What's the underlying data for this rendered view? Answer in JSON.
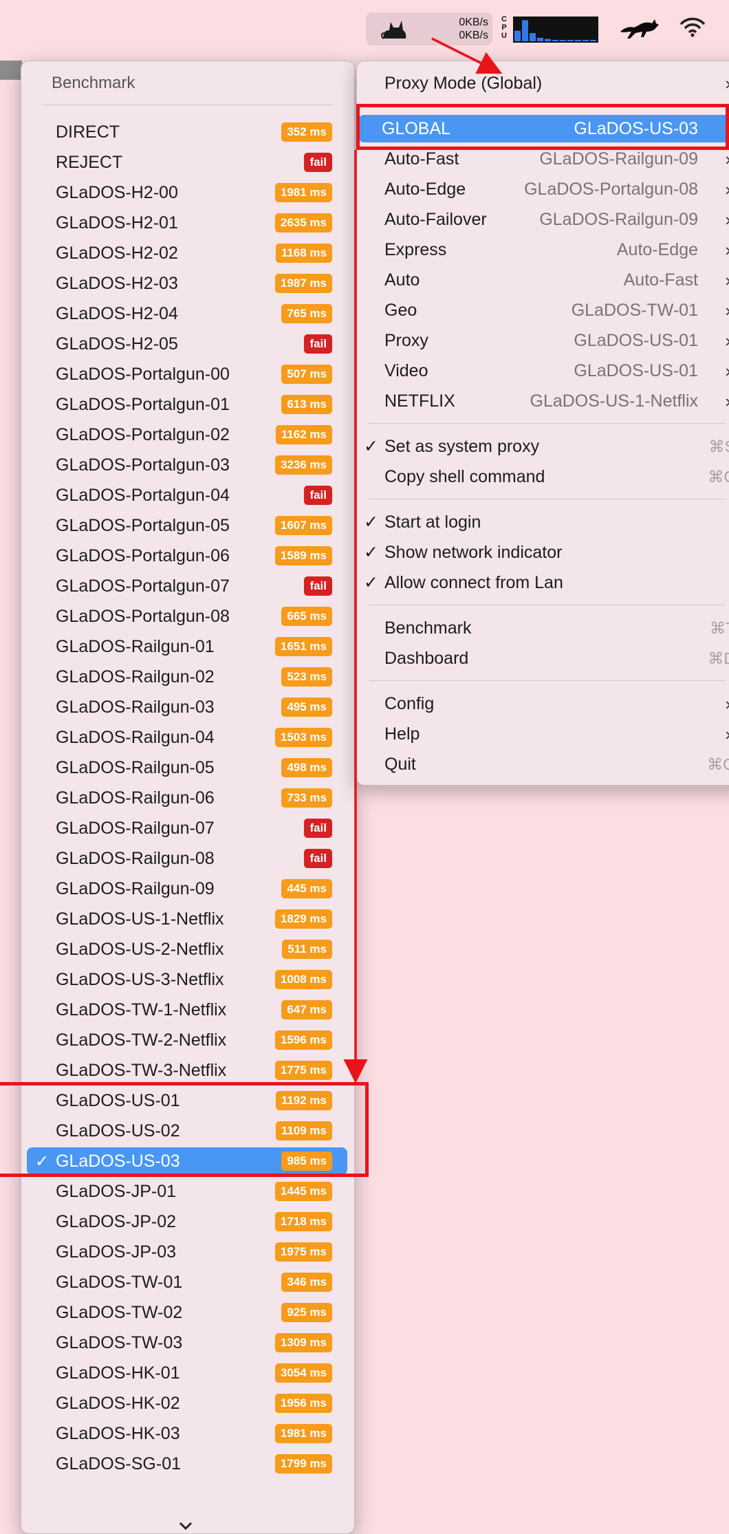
{
  "menubar": {
    "upload_rate": "0KB/s",
    "download_rate": "0KB/s",
    "cpu_label": "CPU",
    "cpu_levels": [
      0.45,
      0.9,
      0.35,
      0.15,
      0.1,
      0.05,
      0.05,
      0.05,
      0.05,
      0.05,
      0.05
    ],
    "icons": [
      "cat-icon",
      "cpu-graph",
      "runcat-icon",
      "wifi-icon"
    ]
  },
  "benchmark_menu": {
    "title": "Benchmark",
    "items": [
      {
        "label": "DIRECT",
        "latency": "352 ms",
        "status": "ok"
      },
      {
        "label": "REJECT",
        "latency": "fail",
        "status": "fail"
      },
      {
        "label": "GLaDOS-H2-00",
        "latency": "1981 ms",
        "status": "ok"
      },
      {
        "label": "GLaDOS-H2-01",
        "latency": "2635 ms",
        "status": "ok"
      },
      {
        "label": "GLaDOS-H2-02",
        "latency": "1168 ms",
        "status": "ok"
      },
      {
        "label": "GLaDOS-H2-03",
        "latency": "1987 ms",
        "status": "ok"
      },
      {
        "label": "GLaDOS-H2-04",
        "latency": "765 ms",
        "status": "ok"
      },
      {
        "label": "GLaDOS-H2-05",
        "latency": "fail",
        "status": "fail"
      },
      {
        "label": "GLaDOS-Portalgun-00",
        "latency": "507 ms",
        "status": "ok"
      },
      {
        "label": "GLaDOS-Portalgun-01",
        "latency": "613 ms",
        "status": "ok"
      },
      {
        "label": "GLaDOS-Portalgun-02",
        "latency": "1162 ms",
        "status": "ok"
      },
      {
        "label": "GLaDOS-Portalgun-03",
        "latency": "3236 ms",
        "status": "ok"
      },
      {
        "label": "GLaDOS-Portalgun-04",
        "latency": "fail",
        "status": "fail"
      },
      {
        "label": "GLaDOS-Portalgun-05",
        "latency": "1607 ms",
        "status": "ok"
      },
      {
        "label": "GLaDOS-Portalgun-06",
        "latency": "1589 ms",
        "status": "ok"
      },
      {
        "label": "GLaDOS-Portalgun-07",
        "latency": "fail",
        "status": "fail"
      },
      {
        "label": "GLaDOS-Portalgun-08",
        "latency": "665 ms",
        "status": "ok"
      },
      {
        "label": "GLaDOS-Railgun-01",
        "latency": "1651 ms",
        "status": "ok"
      },
      {
        "label": "GLaDOS-Railgun-02",
        "latency": "523 ms",
        "status": "ok"
      },
      {
        "label": "GLaDOS-Railgun-03",
        "latency": "495 ms",
        "status": "ok"
      },
      {
        "label": "GLaDOS-Railgun-04",
        "latency": "1503 ms",
        "status": "ok"
      },
      {
        "label": "GLaDOS-Railgun-05",
        "latency": "498 ms",
        "status": "ok"
      },
      {
        "label": "GLaDOS-Railgun-06",
        "latency": "733 ms",
        "status": "ok"
      },
      {
        "label": "GLaDOS-Railgun-07",
        "latency": "fail",
        "status": "fail"
      },
      {
        "label": "GLaDOS-Railgun-08",
        "latency": "fail",
        "status": "fail"
      },
      {
        "label": "GLaDOS-Railgun-09",
        "latency": "445 ms",
        "status": "ok"
      },
      {
        "label": "GLaDOS-US-1-Netflix",
        "latency": "1829 ms",
        "status": "ok"
      },
      {
        "label": "GLaDOS-US-2-Netflix",
        "latency": "511 ms",
        "status": "ok"
      },
      {
        "label": "GLaDOS-US-3-Netflix",
        "latency": "1008 ms",
        "status": "ok"
      },
      {
        "label": "GLaDOS-TW-1-Netflix",
        "latency": "647 ms",
        "status": "ok"
      },
      {
        "label": "GLaDOS-TW-2-Netflix",
        "latency": "1596 ms",
        "status": "ok"
      },
      {
        "label": "GLaDOS-TW-3-Netflix",
        "latency": "1775 ms",
        "status": "ok"
      },
      {
        "label": "GLaDOS-US-01",
        "latency": "1192 ms",
        "status": "ok"
      },
      {
        "label": "GLaDOS-US-02",
        "latency": "1109 ms",
        "status": "ok"
      },
      {
        "label": "GLaDOS-US-03",
        "latency": "985 ms",
        "status": "ok",
        "selected": true,
        "check": "✓"
      },
      {
        "label": "GLaDOS-JP-01",
        "latency": "1445 ms",
        "status": "ok"
      },
      {
        "label": "GLaDOS-JP-02",
        "latency": "1718 ms",
        "status": "ok"
      },
      {
        "label": "GLaDOS-JP-03",
        "latency": "1975 ms",
        "status": "ok"
      },
      {
        "label": "GLaDOS-TW-01",
        "latency": "346 ms",
        "status": "ok"
      },
      {
        "label": "GLaDOS-TW-02",
        "latency": "925 ms",
        "status": "ok"
      },
      {
        "label": "GLaDOS-TW-03",
        "latency": "1309 ms",
        "status": "ok"
      },
      {
        "label": "GLaDOS-HK-01",
        "latency": "3054 ms",
        "status": "ok"
      },
      {
        "label": "GLaDOS-HK-02",
        "latency": "1956 ms",
        "status": "ok"
      },
      {
        "label": "GLaDOS-HK-03",
        "latency": "1981 ms",
        "status": "ok"
      },
      {
        "label": "GLaDOS-SG-01",
        "latency": "1799 ms",
        "status": "ok"
      }
    ],
    "more_icon": "chevron-down-icon"
  },
  "main_menu": {
    "proxy_mode": {
      "label": "Proxy Mode (Global)",
      "chevron": "›"
    },
    "groups": [
      {
        "label": "GLOBAL",
        "value": "GLaDOS-US-03",
        "selected": true
      },
      {
        "label": "Auto-Fast",
        "value": "GLaDOS-Railgun-09"
      },
      {
        "label": "Auto-Edge",
        "value": "GLaDOS-Portalgun-08"
      },
      {
        "label": "Auto-Failover",
        "value": "GLaDOS-Railgun-09"
      },
      {
        "label": "Express",
        "value": "Auto-Edge"
      },
      {
        "label": "Auto",
        "value": "Auto-Fast"
      },
      {
        "label": "Geo",
        "value": "GLaDOS-TW-01"
      },
      {
        "label": "Proxy",
        "value": "GLaDOS-US-01"
      },
      {
        "label": "Video",
        "value": "GLaDOS-US-01"
      },
      {
        "label": "NETFLIX",
        "value": "GLaDOS-US-1-Netflix"
      }
    ],
    "chevron": "›",
    "system": [
      {
        "label": "Set as system proxy",
        "checked": true,
        "shortcut": "⌘S"
      },
      {
        "label": "Copy shell command",
        "checked": false,
        "shortcut": "⌘C"
      }
    ],
    "toggles": [
      {
        "label": "Start at login",
        "checked": true
      },
      {
        "label": "Show network indicator",
        "checked": true
      },
      {
        "label": "Allow connect from Lan",
        "checked": true
      }
    ],
    "tools": [
      {
        "label": "Benchmark",
        "shortcut": "⌘T"
      },
      {
        "label": "Dashboard",
        "shortcut": "⌘D"
      }
    ],
    "footer": [
      {
        "label": "Config",
        "chevron": true
      },
      {
        "label": "Help",
        "chevron": true
      },
      {
        "label": "Quit",
        "shortcut": "⌘Q"
      }
    ],
    "check_glyph": "✓"
  },
  "colors": {
    "background": "#fbdde2",
    "menu": "#f3e5e9",
    "selection": "#4a97f3",
    "badge_ok": "#f79b1b",
    "badge_fail": "#d42222",
    "annotation": "#e8141a"
  }
}
